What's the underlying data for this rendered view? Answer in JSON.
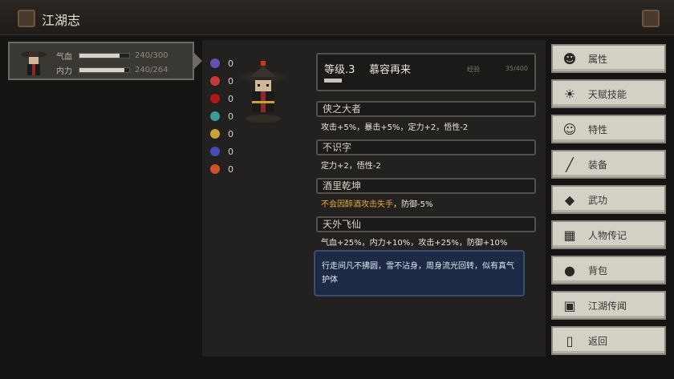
{
  "title_bar": {
    "title": "江湖志"
  },
  "character": {
    "hp_label": "气血",
    "hp_value": "240/300",
    "hp_fraction": 0.8,
    "mp_label": "内力",
    "mp_value": "240/264",
    "mp_fraction": 0.91
  },
  "statuses": [
    {
      "icon": "purple-skull-icon",
      "color": "#6a4fb0",
      "count": "0"
    },
    {
      "icon": "broken-heart-icon",
      "color": "#c23a3a",
      "count": "0"
    },
    {
      "icon": "red-blob-icon",
      "color": "#b01818",
      "count": "0"
    },
    {
      "icon": "teal-cat-icon",
      "color": "#3e9a9a",
      "count": "0"
    },
    {
      "icon": "gold-sparkle-icon",
      "color": "#c9a23a",
      "count": "0"
    },
    {
      "icon": "blue-face-icon",
      "color": "#4a4ab8",
      "count": "0"
    },
    {
      "icon": "flame-icon",
      "color": "#d0502a",
      "count": "0"
    }
  ],
  "level": {
    "level_text": "等级.3",
    "name": "慕容再来",
    "exp_label": "经验",
    "exp_value": "35/400",
    "exp_fraction": 0.0875
  },
  "traits": [
    {
      "name": "侠之大者",
      "desc": "攻击+5%，暴击+5%，定力+2，悟性-2"
    },
    {
      "name": "不识字",
      "desc": "定力+2，悟性-2"
    },
    {
      "name": "酒里乾坤",
      "desc_warn": "不会因醉酒攻击失手",
      "desc_rest": "，防御-5%"
    },
    {
      "name": "天外飞仙",
      "desc": "气血+25%，内力+10%，攻击+25%，防御+10%"
    }
  ],
  "tooltip": {
    "text": "行走间凡不拂圆，雪不沾身，周身流光回转，似有真气护体"
  },
  "menu": [
    {
      "label": "属性",
      "icon": "person-icon"
    },
    {
      "label": "天赋技能",
      "icon": "aura-person-icon"
    },
    {
      "label": "特性",
      "icon": "person-traits-icon"
    },
    {
      "label": "装备",
      "icon": "sword-icon"
    },
    {
      "label": "武功",
      "icon": "scroll-icon"
    },
    {
      "label": "人物传记",
      "icon": "book-icon"
    },
    {
      "label": "背包",
      "icon": "bag-icon"
    },
    {
      "label": "江湖传闻",
      "icon": "monitor-icon"
    },
    {
      "label": "返回",
      "icon": "door-icon"
    }
  ]
}
